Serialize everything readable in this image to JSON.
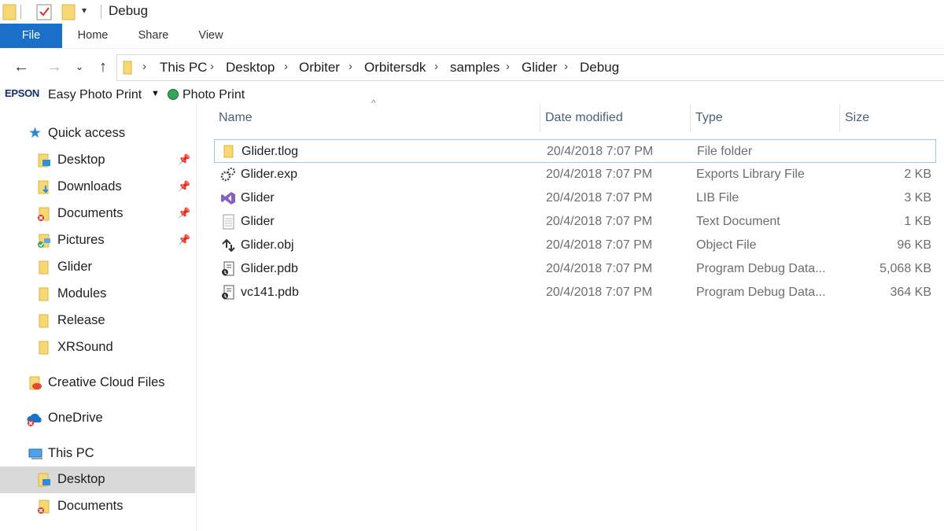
{
  "window": {
    "title": "Debug"
  },
  "ribbon": {
    "tabs": [
      "File",
      "Home",
      "Share",
      "View"
    ]
  },
  "address": {
    "crumbs": [
      "This PC",
      "Desktop",
      "Orbiter",
      "Orbitersdk",
      "samples",
      "Glider",
      "Debug"
    ]
  },
  "favorites_bar": {
    "brand": "EPSON",
    "item1": "Easy Photo Print",
    "item2": "Photo Print"
  },
  "sidebar": {
    "quick_access": "Quick access",
    "items": [
      {
        "label": "Desktop",
        "icon": "desktop-folder-icon",
        "pinned": true
      },
      {
        "label": "Downloads",
        "icon": "downloads-folder-icon",
        "pinned": true
      },
      {
        "label": "Documents",
        "icon": "documents-folder-icon",
        "pinned": true
      },
      {
        "label": "Pictures",
        "icon": "pictures-folder-icon",
        "pinned": true
      },
      {
        "label": "Glider",
        "icon": "folder-icon",
        "pinned": false
      },
      {
        "label": "Modules",
        "icon": "folder-icon",
        "pinned": false
      },
      {
        "label": "Release",
        "icon": "folder-icon",
        "pinned": false
      },
      {
        "label": "XRSound",
        "icon": "folder-icon",
        "pinned": false
      }
    ],
    "creative_cloud": "Creative Cloud Files",
    "onedrive": "OneDrive",
    "this_pc": "This PC",
    "this_pc_items": [
      {
        "label": "Desktop",
        "selected": true
      },
      {
        "label": "Documents",
        "selected": false
      }
    ]
  },
  "columns": {
    "name": "Name",
    "date": "Date modified",
    "type": "Type",
    "size": "Size"
  },
  "files": [
    {
      "name": "Glider.tlog",
      "date": "20/4/2018 7:07 PM",
      "type": "File folder",
      "size": "",
      "icon": "folder-icon"
    },
    {
      "name": "Glider.exp",
      "date": "20/4/2018 7:07 PM",
      "type": "Exports Library File",
      "size": "2 KB",
      "icon": "gears-file-icon"
    },
    {
      "name": "Glider",
      "date": "20/4/2018 7:07 PM",
      "type": "LIB File",
      "size": "3 KB",
      "icon": "visual-studio-icon"
    },
    {
      "name": "Glider",
      "date": "20/4/2018 7:07 PM",
      "type": "Text Document",
      "size": "1 KB",
      "icon": "text-document-icon"
    },
    {
      "name": "Glider.obj",
      "date": "20/4/2018 7:07 PM",
      "type": "Object File",
      "size": "96 KB",
      "icon": "object-file-icon"
    },
    {
      "name": "Glider.pdb",
      "date": "20/4/2018 7:07 PM",
      "type": "Program Debug Data...",
      "size": "5,068 KB",
      "icon": "pdb-file-icon"
    },
    {
      "name": "vc141.pdb",
      "date": "20/4/2018 7:07 PM",
      "type": "Program Debug Data...",
      "size": "364 KB",
      "icon": "pdb-file-icon"
    }
  ]
}
